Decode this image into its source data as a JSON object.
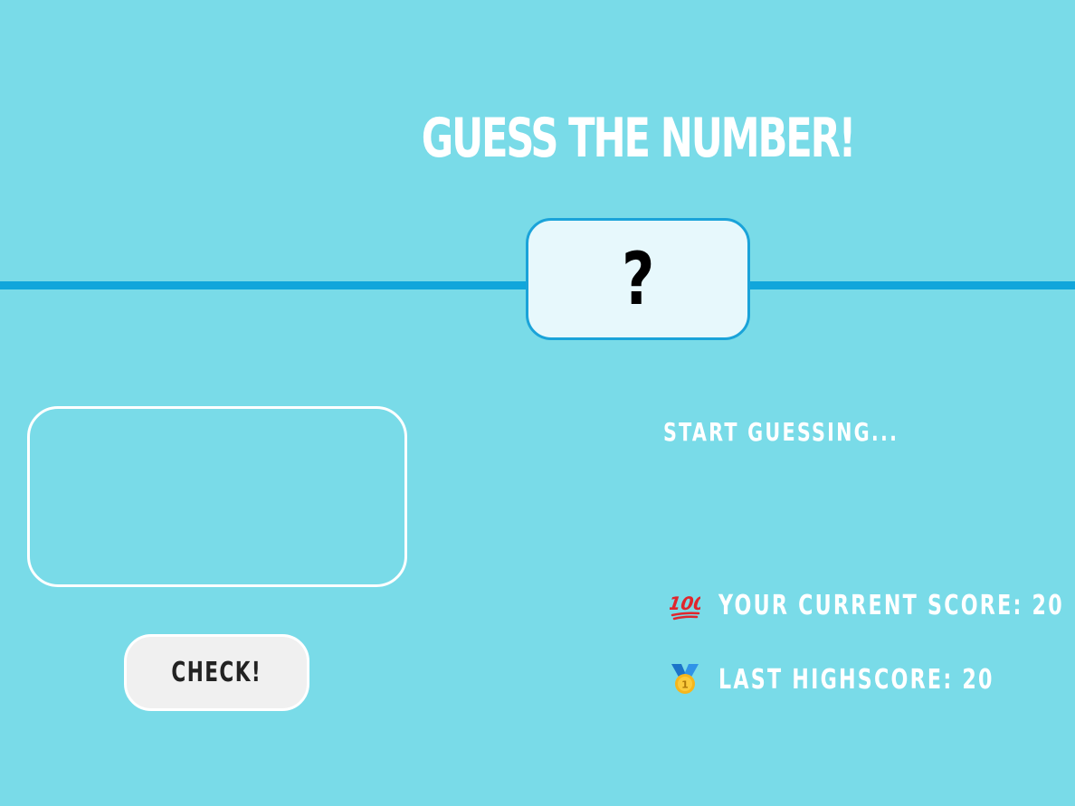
{
  "header": {
    "title": "GUESS THE NUMBER!"
  },
  "secret": {
    "display": "?"
  },
  "input": {
    "value": "",
    "placeholder": ""
  },
  "actions": {
    "check_label": "CHECK!"
  },
  "status": {
    "message": "START GUESSING..."
  },
  "stats": {
    "score_icon": "hundred-points-icon",
    "score_label": "YOUR CURRENT SCORE: 20",
    "highscore_icon": "medal-icon",
    "highscore_label": "LAST HIGHSCORE: 20"
  },
  "colors": {
    "background": "#79dbe8",
    "divider": "#11a6db",
    "secret_box_bg": "#e7f8fc",
    "secret_box_border": "#1aa3d9",
    "text": "#ffffff",
    "button_bg": "#f0f0f0"
  }
}
